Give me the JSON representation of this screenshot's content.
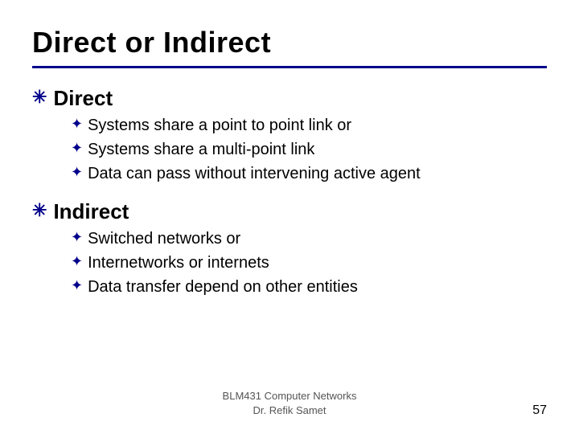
{
  "slide": {
    "title": "Direct or Indirect",
    "sections": [
      {
        "id": "direct",
        "label": "Direct",
        "sub_items": [
          "Systems share a point to point link or",
          "Systems share a multi-point link",
          "Data can pass without intervening active agent"
        ]
      },
      {
        "id": "indirect",
        "label": "Indirect",
        "sub_items": [
          "Switched networks or",
          "Internetworks or internets",
          "Data transfer depend on other entities"
        ]
      }
    ],
    "footer": {
      "line1": "BLM431 Computer Networks",
      "line2": "Dr. Refik Samet",
      "page": "57"
    }
  }
}
